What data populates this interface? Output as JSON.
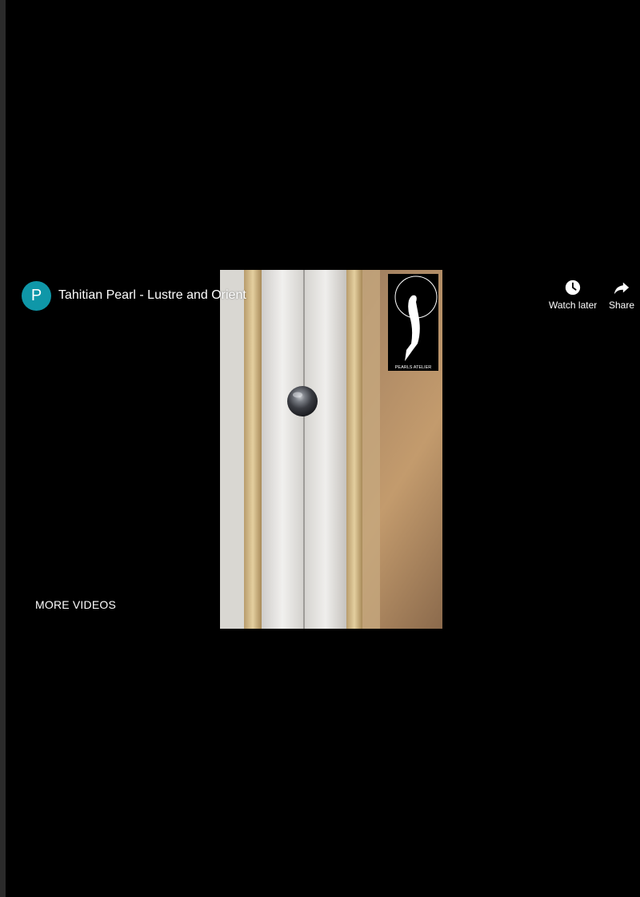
{
  "player": {
    "channel_initial": "P",
    "channel_color": "#0f97a8",
    "title": "Tahitian Pearl - Lustre and Orient",
    "actions": {
      "watch_later_label": "Watch later",
      "watch_later_icon": "clock-icon",
      "share_label": "Share",
      "share_icon": "share-arrow-icon"
    },
    "more_videos_label": "MORE VIDEOS",
    "video": {
      "watermark_text": "PEARLS ATELIER"
    }
  }
}
